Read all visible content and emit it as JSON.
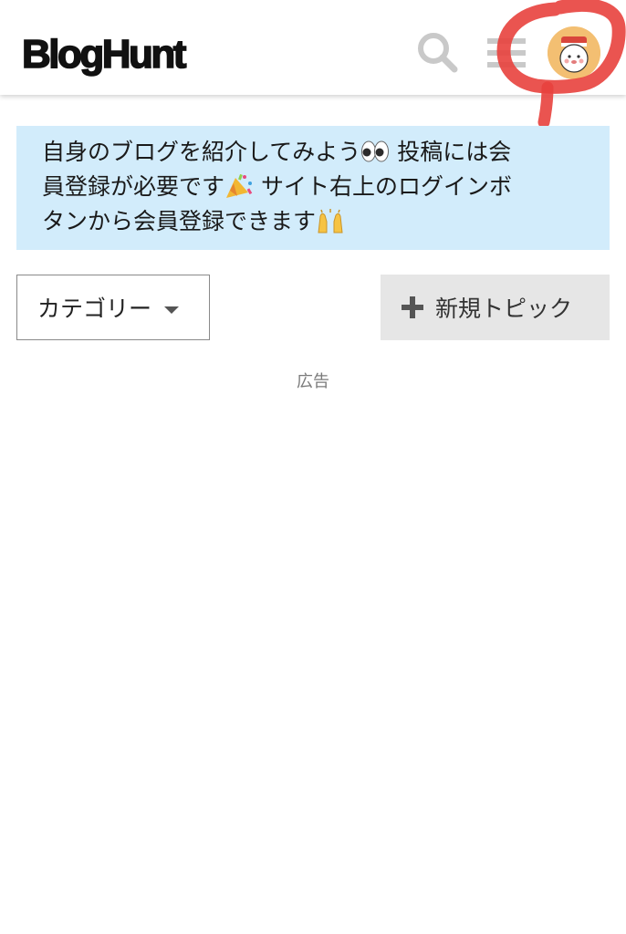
{
  "header": {
    "logo": "BlogHunt",
    "search_icon": "search-icon",
    "menu_icon": "hamburger-menu-icon",
    "avatar_icon": "user-avatar-icon",
    "avatar_bg": "#f3bf72",
    "annotation_color": "#e8413d"
  },
  "notice": {
    "line1": "自身のブログを紹介してみよう",
    "line1_emoji": "eyes-emoji",
    "line1_tail": " 投稿には会",
    "line2": "員登録が必要です",
    "line2_emoji": "party-popper-emoji",
    "line2_tail": " サイト右上のログインボ",
    "line3": "タンから会員登録できます",
    "line3_emoji": "raising-hands-emoji",
    "background": "#d2ecfb"
  },
  "controls": {
    "category_label": "カテゴリー",
    "category_icon": "caret-down-icon",
    "new_topic_label": "新規トピック",
    "new_topic_icon": "plus-icon"
  },
  "ad": {
    "label": "広告"
  }
}
